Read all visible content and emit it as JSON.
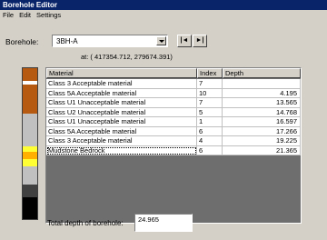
{
  "window": {
    "title": "Borehole Editor"
  },
  "menu": [
    "File",
    "Edit",
    "Settings"
  ],
  "borehole": {
    "label": "Borehole:",
    "selected": "3BH-A",
    "coords": "at: ( 417354.712, 279674.391)"
  },
  "nav": {
    "prev": "|◄",
    "next": "►|"
  },
  "table": {
    "headers": [
      "Material",
      "Index",
      "Depth"
    ],
    "rows": [
      {
        "material": "Class 3 Acceptable material",
        "index": "7",
        "depth": ""
      },
      {
        "material": "Class 5A Acceptable material",
        "index": "10",
        "depth": "4.195"
      },
      {
        "material": "Class U1 Unacceptable material",
        "index": "7",
        "depth": "13.565"
      },
      {
        "material": "Class U2 Unacceptable material",
        "index": "5",
        "depth": "14.768"
      },
      {
        "material": "Class U1 Unacceptable material",
        "index": "1",
        "depth": "16.597"
      },
      {
        "material": "Class 5A Acceptable material",
        "index": "6",
        "depth": "17.266"
      },
      {
        "material": "Class 3 Acceptable material",
        "index": "4",
        "depth": "19.225"
      },
      {
        "material": "Mudstone Bedrock",
        "index": "6",
        "depth": "21.365"
      }
    ]
  },
  "strip_colors": [
    "#b55a10",
    "#ffffff",
    "#b55a10",
    "#c0c0c0",
    "#ffff33",
    "#ffb000",
    "#ffff33",
    "#c0c0c0",
    "#404040",
    "#000000"
  ],
  "total": {
    "label": "Total depth of borehole:",
    "value": "24.965"
  }
}
